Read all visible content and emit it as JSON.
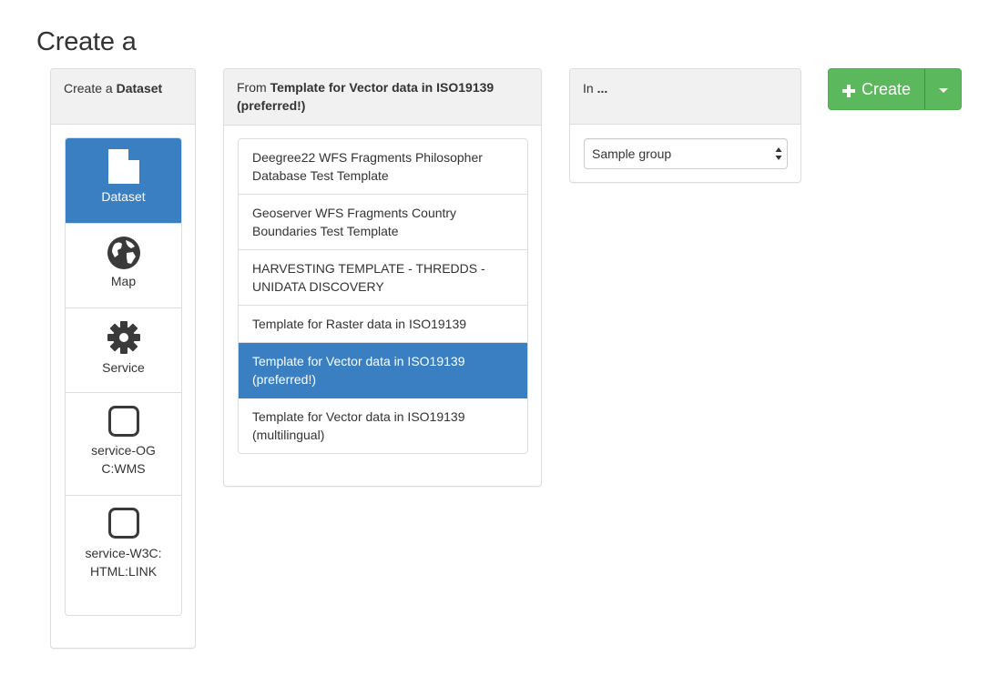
{
  "page": {
    "title": "Create a"
  },
  "type_panel": {
    "heading_prefix": "Create a",
    "heading_value": "Dataset",
    "items": [
      {
        "label": "Dataset",
        "icon": "file-icon",
        "active": true
      },
      {
        "label": "Map",
        "icon": "globe-icon",
        "active": false
      },
      {
        "label": "Service",
        "icon": "gear-icon",
        "active": false
      },
      {
        "label": "service-OGC:WMS",
        "icon": "square-icon",
        "active": false
      },
      {
        "label": "service-W3C:HTML:LINK",
        "icon": "square-icon",
        "active": false
      }
    ]
  },
  "template_panel": {
    "heading_prefix": "From",
    "heading_value": "Template for Vector data in ISO19139 (preferred!)",
    "items": [
      {
        "label": "Deegree22 WFS Fragments Philosopher Database Test Template",
        "active": false
      },
      {
        "label": "Geoserver WFS Fragments Country Boundaries Test Template",
        "active": false
      },
      {
        "label": "HARVESTING TEMPLATE - THREDDS - UNIDATA DISCOVERY",
        "active": false
      },
      {
        "label": "Template for Raster data in ISO19139",
        "active": false
      },
      {
        "label": "Template for Vector data in ISO19139 (preferred!)",
        "active": true
      },
      {
        "label": "Template for Vector data in ISO19139 (multilingual)",
        "active": false
      }
    ]
  },
  "group_panel": {
    "heading_prefix": "In",
    "heading_value": "...",
    "select": {
      "value": "Sample group"
    }
  },
  "create_button": {
    "label": "Create",
    "icon": "plus-icon",
    "caret_icon": "caret-down-icon"
  },
  "colors": {
    "primary": "#3a7fc1",
    "success": "#5cb85c",
    "panel_heading_bg": "#f1f1f1",
    "border": "#dddddd"
  }
}
